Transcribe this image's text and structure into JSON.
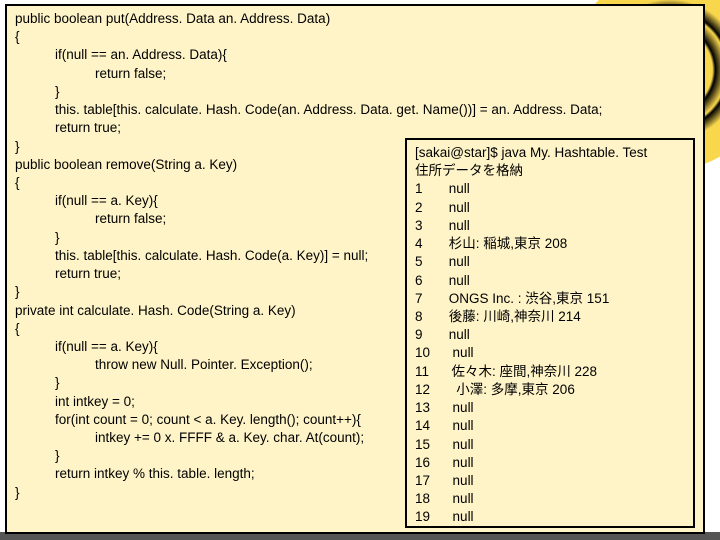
{
  "code": {
    "l1": "public boolean put(Address. Data an. Address. Data)",
    "l2": "{",
    "l3": "if(null == an. Address. Data){",
    "l4": "return false;",
    "l5": "}",
    "l6": "this. table[this. calculate. Hash. Code(an. Address. Data. get. Name())] = an. Address. Data;",
    "l7": "return true;",
    "l8": "}",
    "l9": "public boolean remove(String a. Key)",
    "l10": "{",
    "l11": "if(null == a. Key){",
    "l12": "return false;",
    "l13": "}",
    "l14": "this. table[this. calculate. Hash. Code(a. Key)] = null;",
    "l15": "return true;",
    "l16": "}",
    "l17": "private int calculate. Hash. Code(String a. Key)",
    "l18": "{",
    "l19": "if(null == a. Key){",
    "l20": "throw new Null. Pointer. Exception();",
    "l21": "}",
    "l22": "int intkey = 0;",
    "l23": "for(int count = 0; count < a. Key. length(); count++){",
    "l24": "intkey += 0 x. FFFF & a. Key. char. At(count);",
    "l25": "}",
    "l26": "return intkey % this. table. length;",
    "l27": "}"
  },
  "output": {
    "cmd": "[sakai@star]$ java My. Hashtable. Test",
    "msg": "住所データを格納",
    "rows": [
      {
        "n": "1",
        "v": "null"
      },
      {
        "n": "2",
        "v": "null"
      },
      {
        "n": "3",
        "v": "null"
      },
      {
        "n": "4",
        "v": "杉山: 稲城,東京 208"
      },
      {
        "n": "5",
        "v": "null"
      },
      {
        "n": "6",
        "v": "null"
      },
      {
        "n": "7",
        "v": "ONGS Inc. : 渋谷,東京 151"
      },
      {
        "n": "8",
        "v": "後藤: 川崎,神奈川 214"
      },
      {
        "n": "9",
        "v": "null"
      },
      {
        "n": "10",
        "v": "null"
      },
      {
        "n": "11",
        "v": "佐々木: 座間,神奈川 228"
      },
      {
        "n": "12",
        "v": " 小澤: 多摩,東京 206"
      },
      {
        "n": "13",
        "v": "null"
      },
      {
        "n": "14",
        "v": "null"
      },
      {
        "n": "15",
        "v": "null"
      },
      {
        "n": "16",
        "v": "null"
      },
      {
        "n": "17",
        "v": "null"
      },
      {
        "n": "18",
        "v": "null"
      },
      {
        "n": "19",
        "v": "null"
      }
    ]
  }
}
